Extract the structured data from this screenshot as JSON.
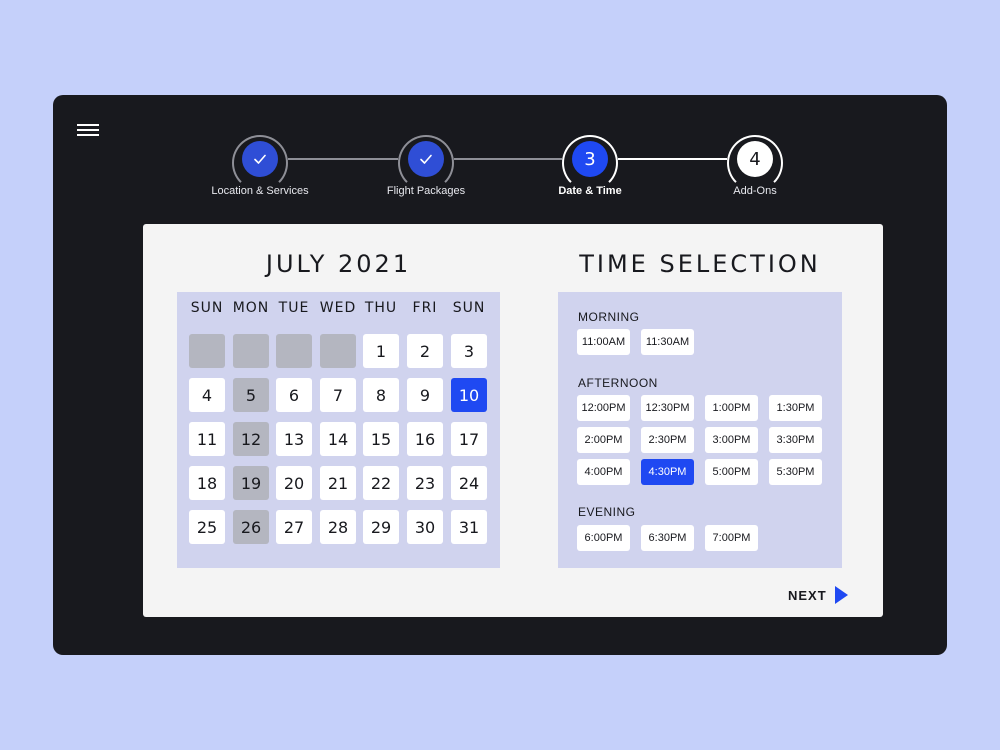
{
  "colors": {
    "background": "#c5d0fa",
    "device": "#18191e",
    "accent": "#1f49f2",
    "done": "#2f4ed6",
    "panel": "#d0d3ee",
    "disabled": "#b4b6c0"
  },
  "header": {
    "menu_icon": "hamburger-menu-icon"
  },
  "steps": [
    {
      "label": "Location & Services",
      "state": "done",
      "icon": "check-icon"
    },
    {
      "label": "Flight Packages",
      "state": "done",
      "icon": "check-icon"
    },
    {
      "label": "Date & Time",
      "number": "3",
      "state": "current"
    },
    {
      "label": "Add-Ons",
      "number": "4",
      "state": "upcoming"
    }
  ],
  "calendar": {
    "title": "JULY 2021",
    "weekdays": [
      "SUN",
      "MON",
      "TUE",
      "WED",
      "THU",
      "FRI",
      "SUN"
    ],
    "leading_blanks": 4,
    "days_in_month": 31,
    "disabled_days": [
      5,
      12,
      19,
      26
    ],
    "selected_day": 10
  },
  "time_selection": {
    "title": "TIME SELECTION",
    "sections": [
      {
        "label": "MORNING",
        "slots": [
          "11:00AM",
          "11:30AM"
        ]
      },
      {
        "label": "AFTERNOON",
        "slots": [
          "12:00PM",
          "12:30PM",
          "1:00PM",
          "1:30PM",
          "2:00PM",
          "2:30PM",
          "3:00PM",
          "3:30PM",
          "4:00PM",
          "4:30PM",
          "5:00PM",
          "5:30PM"
        ]
      },
      {
        "label": "EVENING",
        "slots": [
          "6:00PM",
          "6:30PM",
          "7:00PM"
        ]
      }
    ],
    "selected_slot": "4:30PM"
  },
  "next": {
    "label": "NEXT",
    "icon": "play-arrow-icon"
  }
}
